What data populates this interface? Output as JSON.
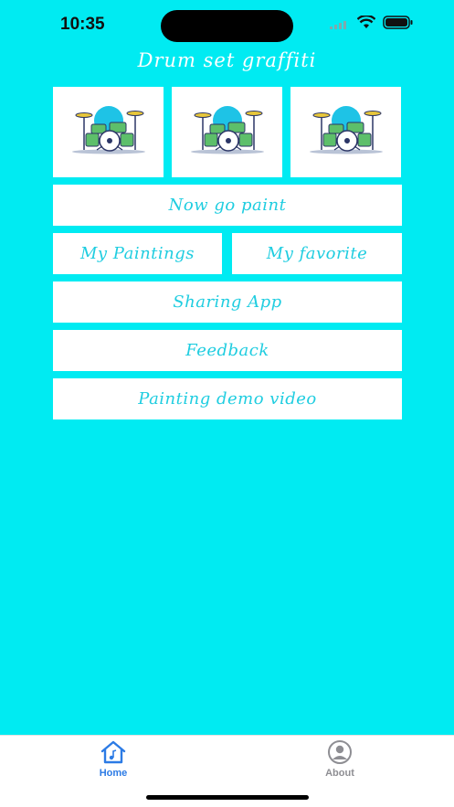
{
  "status": {
    "time": "10:35"
  },
  "header": {
    "title": "Drum set graffiti"
  },
  "tiles": [
    {
      "icon": "drum-set-icon"
    },
    {
      "icon": "drum-set-icon"
    },
    {
      "icon": "drum-set-icon"
    }
  ],
  "buttons": {
    "paint": "Now go paint",
    "my_paintings": "My Paintings",
    "my_favorite": "My favorite",
    "sharing": "Sharing App",
    "feedback": "Feedback",
    "demo": "Painting demo video"
  },
  "tabbar": {
    "home_label": "Home",
    "about_label": "About",
    "active_color": "#2c7be5",
    "inactive_color": "#8e8e93"
  },
  "colors": {
    "background": "#00ebf2",
    "button_text": "#1fcde0"
  }
}
